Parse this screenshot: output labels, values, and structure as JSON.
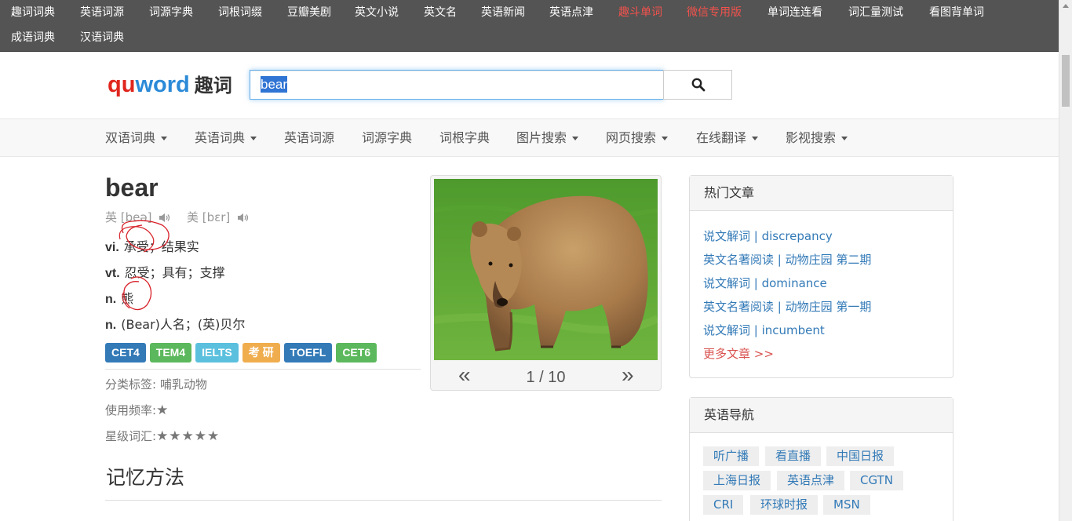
{
  "topnav": [
    {
      "label": "趣词词典",
      "red": false
    },
    {
      "label": "英语词源",
      "red": false
    },
    {
      "label": "词源字典",
      "red": false
    },
    {
      "label": "词根词缀",
      "red": false
    },
    {
      "label": "豆瓣美剧",
      "red": false
    },
    {
      "label": "英文小说",
      "red": false
    },
    {
      "label": "英文名",
      "red": false
    },
    {
      "label": "英语新闻",
      "red": false
    },
    {
      "label": "英语点津",
      "red": false
    },
    {
      "label": "趣斗单词",
      "red": true
    },
    {
      "label": "微信专用版",
      "red": true
    },
    {
      "label": "单词连连看",
      "red": false
    },
    {
      "label": "词汇量测试",
      "red": false
    },
    {
      "label": "看图背单词",
      "red": false
    },
    {
      "label": "成语词典",
      "red": false
    },
    {
      "label": "汉语词典",
      "red": false
    }
  ],
  "logo": {
    "qu": "qu",
    "word": "word",
    "cn": "趣词"
  },
  "search": {
    "value": "bear",
    "icon": "search-icon"
  },
  "mainnav": [
    {
      "label": "双语词典",
      "dropdown": true
    },
    {
      "label": "英语词典",
      "dropdown": true
    },
    {
      "label": "英语词源",
      "dropdown": false
    },
    {
      "label": "词源字典",
      "dropdown": false
    },
    {
      "label": "词根字典",
      "dropdown": false
    },
    {
      "label": "图片搜索",
      "dropdown": true
    },
    {
      "label": "网页搜索",
      "dropdown": true
    },
    {
      "label": "在线翻译",
      "dropdown": true
    },
    {
      "label": "影视搜索",
      "dropdown": true
    }
  ],
  "entry": {
    "word": "bear",
    "phonetic_uk": "英 [beə]",
    "phonetic_us": "美 [bɛr]",
    "definitions": [
      {
        "pos": "vi.",
        "text": "承受；结果实"
      },
      {
        "pos": "vt.",
        "text": "忍受；具有；支撑"
      },
      {
        "pos": "n.",
        "text": "熊"
      },
      {
        "pos": "n.",
        "text": "(Bear)人名；(英)贝尔"
      }
    ],
    "tags": [
      {
        "label": "CET4",
        "color": "#337ab7"
      },
      {
        "label": "TEM4",
        "color": "#5cb85c"
      },
      {
        "label": "IELTS",
        "color": "#5bc0de"
      },
      {
        "label": "考 研",
        "color": "#f0ad4e"
      },
      {
        "label": "TOEFL",
        "color": "#337ab7"
      },
      {
        "label": "CET6",
        "color": "#5cb85c"
      }
    ],
    "category_label": "分类标签:",
    "category_value": "哺乳动物",
    "frequency_label": "使用频率:",
    "frequency_stars": "★",
    "star_label": "星级词汇:",
    "star_rating": "★★★★★",
    "memory_heading": "记忆方法"
  },
  "image_viewer": {
    "prev": "«",
    "next": "»",
    "page": "1 / 10"
  },
  "hot_articles": {
    "title": "热门文章",
    "items": [
      "说文解词 | discrepancy",
      "英文名著阅读 | 动物庄园 第二期",
      "说文解词 | dominance",
      "英文名著阅读 | 动物庄园 第一期",
      "说文解词 | incumbent"
    ],
    "more": "更多文章 >>"
  },
  "english_nav": {
    "title": "英语导航",
    "items": [
      "听广播",
      "看直播",
      "中国日报",
      "上海日报",
      "英语点津",
      "CGTN",
      "CRI",
      "环球时报",
      "MSN"
    ]
  }
}
